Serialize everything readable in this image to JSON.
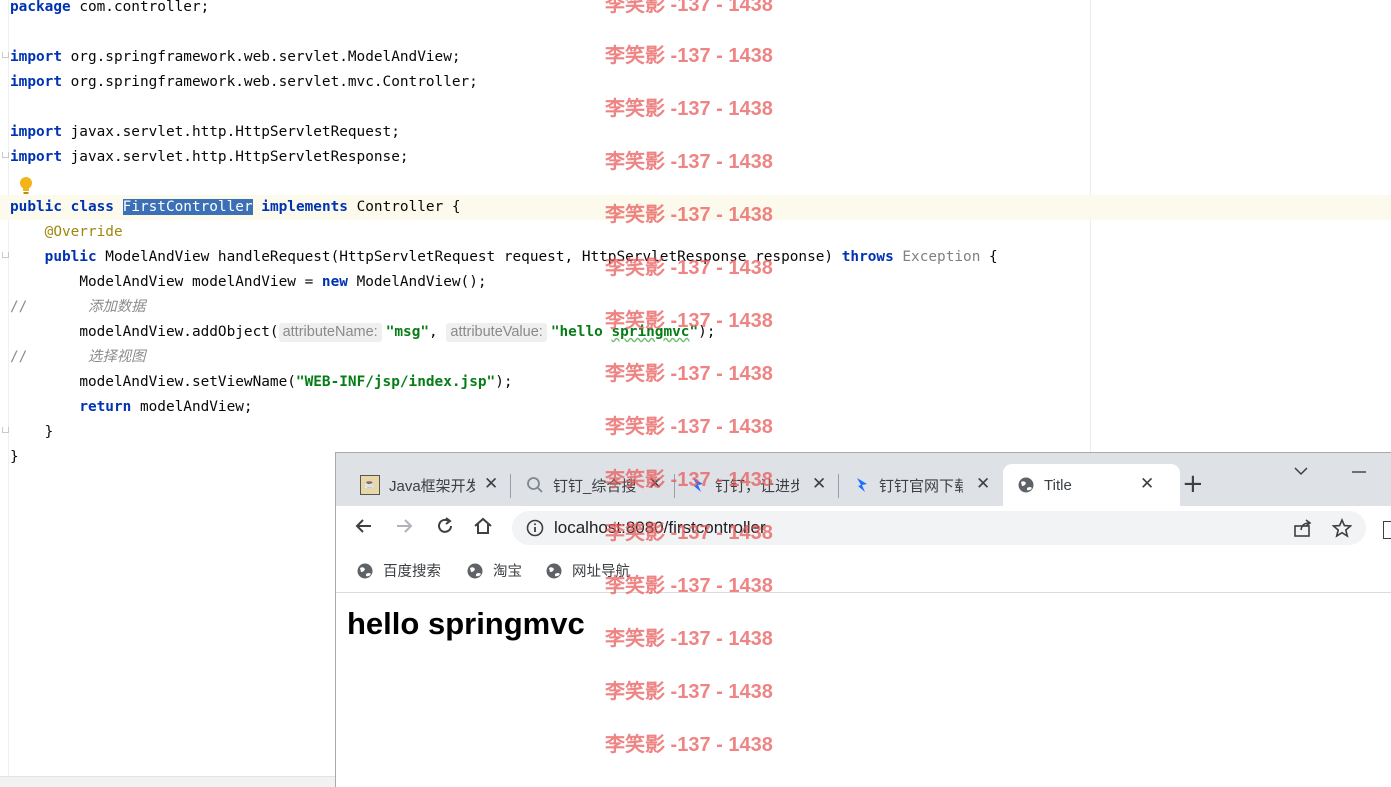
{
  "editor": {
    "lines": {
      "l1": {
        "kw": "package",
        "rest": " com.controller;"
      },
      "l3": {
        "kw": "import",
        "rest": " org.springframework.web.servlet.ModelAndView;"
      },
      "l4": {
        "kw": "import",
        "rest": " org.springframework.web.servlet.mvc.Controller;"
      },
      "l6": {
        "kw": "import",
        "rest": " javax.servlet.http.HttpServletRequest;"
      },
      "l7": {
        "kw": "import",
        "rest": " javax.servlet.http.HttpServletResponse;"
      },
      "l9": {
        "kw1": "public",
        "kw2": "class",
        "sel": "FirstController",
        "kw3": "implements",
        "rest": " Controller {"
      },
      "l10": {
        "ann": "@Override"
      },
      "l11": {
        "kw1": "public",
        "mid": " ModelAndView handleRequest(HttpServletRequest request, HttpServletResponse response) ",
        "kw2": "throws",
        "exc": " Exception",
        "rest": " {"
      },
      "l12": {
        "a": "ModelAndView modelAndView = ",
        "kw": "new",
        "b": " ModelAndView();"
      },
      "l13": {
        "cm": "//",
        "cn": "添加数据"
      },
      "l14": {
        "a": "modelAndView.addObject(",
        "hint1": "attributeName:",
        "s1": "\"msg\"",
        "comma": ",",
        "hint2": "attributeValue:",
        "s2a": "\"hello ",
        "s2b": "springmvc",
        "s2c": "\"",
        "b": ");"
      },
      "l15": {
        "cm": "//",
        "cn": "选择视图"
      },
      "l16": {
        "a": "modelAndView.setViewName(",
        "s": "\"WEB-INF/jsp/index.jsp\"",
        "b": ");"
      },
      "l17": {
        "kw": "return",
        "rest": " modelAndView;"
      },
      "l18": {
        "text": "}"
      },
      "l19": {
        "text": "}"
      }
    }
  },
  "browser": {
    "tabs": [
      {
        "label": "Java框架开发",
        "icon": "java-icon"
      },
      {
        "label": "钉钉_综合搜索",
        "icon": "search-icon"
      },
      {
        "label": "钉钉，让进步",
        "icon": "dingtalk-icon"
      },
      {
        "label": "钉钉官网下载",
        "icon": "dingtalk-icon"
      },
      {
        "label": "Title",
        "icon": "globe-icon"
      }
    ],
    "close_glyph": "✕",
    "new_tab_glyph": "+",
    "url": "localhost:8080/firstcontroller",
    "bookmarks": [
      {
        "label": "百度搜索"
      },
      {
        "label": "淘宝"
      },
      {
        "label": "网址导航"
      }
    ],
    "page_heading": "hello springmvc"
  },
  "watermark": {
    "text": "李笑影 -137 - 1438",
    "color": "#e85454"
  },
  "colors": {
    "keyword": "#0033b3",
    "string": "#067d17",
    "annotation": "#9e880d",
    "selection": "#3b6fb6"
  }
}
